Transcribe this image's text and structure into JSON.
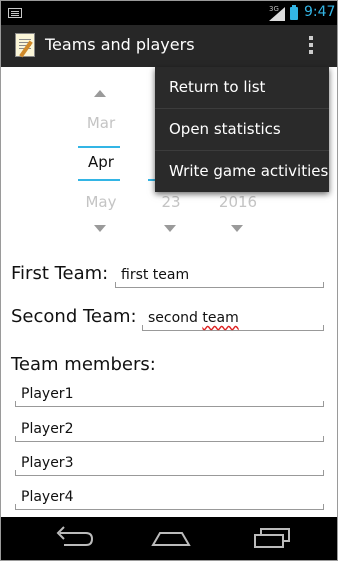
{
  "status_bar": {
    "time": "9:47",
    "network": "3G",
    "icons": [
      "notification-icon",
      "signal-icon",
      "battery-icon"
    ]
  },
  "action_bar": {
    "title": "Teams and players",
    "app_icon": "notepad-icon",
    "overflow_icon": "overflow-menu-icon"
  },
  "date_picker": {
    "month": {
      "prev": "Mar",
      "current": "Apr",
      "next": "May"
    },
    "day": {
      "next": "23"
    },
    "year": {
      "next": "2016"
    }
  },
  "form": {
    "first_team_label": "First Team:",
    "first_team_value": "first team",
    "second_team_label": "Second Team:",
    "second_team_value_word1": "second",
    "second_team_value_word2": "team",
    "members_label": "Team members:",
    "players": [
      "Player1",
      "Player2",
      "Player3",
      "Player4"
    ]
  },
  "menu": {
    "items": [
      "Return to list",
      "Open statistics",
      "Write game activities"
    ]
  },
  "nav_bar": {
    "icons": [
      "back-icon",
      "home-icon",
      "recent-apps-icon"
    ]
  },
  "colors": {
    "accent": "#33b5e5",
    "action_bar": "#272727",
    "menu": "#2a2a2a"
  }
}
